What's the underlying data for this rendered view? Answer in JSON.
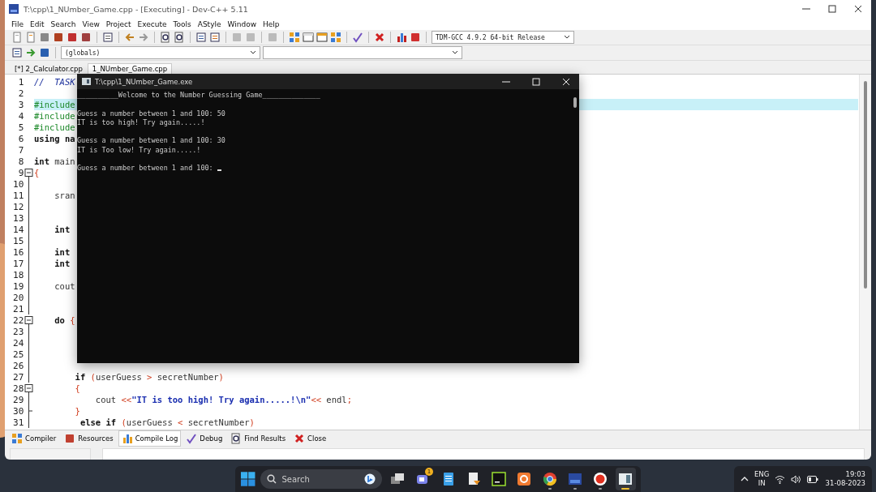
{
  "ide_window": {
    "title": "T:\\cpp\\1_NUmber_Game.cpp - [Executing] - Dev-C++ 5.11"
  },
  "menu": [
    "File",
    "Edit",
    "Search",
    "View",
    "Project",
    "Execute",
    "Tools",
    "AStyle",
    "Window",
    "Help"
  ],
  "compiler_select": {
    "value": "TDM-GCC 4.9.2 64-bit Release"
  },
  "scope_select": {
    "value": "(globals)"
  },
  "file_tabs": [
    {
      "label": "[*] 2_Calculator.cpp",
      "selected": false
    },
    {
      "label": "1_NUmber_Game.cpp",
      "selected": true
    }
  ],
  "code_lines": [
    {
      "number": "1",
      "kind": "plain",
      "highlighted": false,
      "segments": [
        {
          "text": "//  TASK",
          "kind": "comment"
        }
      ]
    },
    {
      "number": "2",
      "kind": "plain",
      "highlighted": false
    },
    {
      "number": "3",
      "kind": "plain",
      "highlighted": true,
      "segments": [
        {
          "text": "#include",
          "kind": "preproc"
        }
      ]
    },
    {
      "number": "4",
      "kind": "plain",
      "highlighted": false,
      "segments": [
        {
          "text": "#include",
          "kind": "preproc"
        }
      ]
    },
    {
      "number": "5",
      "kind": "plain",
      "highlighted": false,
      "segments": [
        {
          "text": "#include",
          "kind": "preproc"
        }
      ]
    },
    {
      "number": "6",
      "kind": "plain",
      "highlighted": false,
      "segments": [
        {
          "text": "using",
          "kind": "keyword"
        },
        {
          "text": " na",
          "kind": "keyword"
        }
      ]
    },
    {
      "number": "7",
      "kind": "plain",
      "highlighted": false
    },
    {
      "number": "8",
      "kind": "plain",
      "highlighted": false,
      "segments": [
        {
          "text": "int",
          "kind": "keyword"
        },
        {
          "text": " main",
          "kind": "plain"
        }
      ]
    },
    {
      "number": "9",
      "kind": "fold-start",
      "highlighted": false,
      "segments": [
        {
          "text": "{",
          "kind": "symbol"
        }
      ]
    },
    {
      "number": "10",
      "kind": "fold-inside",
      "highlighted": false
    },
    {
      "number": "11",
      "kind": "fold-inside",
      "highlighted": false,
      "segments": [
        {
          "text": "    sran",
          "kind": "plain"
        }
      ]
    },
    {
      "number": "12",
      "kind": "fold-inside",
      "highlighted": false
    },
    {
      "number": "13",
      "kind": "fold-inside",
      "highlighted": false
    },
    {
      "number": "14",
      "kind": "fold-inside",
      "highlighted": false,
      "segments": [
        {
          "text": "    int",
          "kind": "keyword"
        }
      ]
    },
    {
      "number": "15",
      "kind": "fold-inside",
      "highlighted": false
    },
    {
      "number": "16",
      "kind": "fold-inside",
      "highlighted": false,
      "segments": [
        {
          "text": "    int",
          "kind": "keyword"
        }
      ]
    },
    {
      "number": "17",
      "kind": "fold-inside",
      "highlighted": false,
      "segments": [
        {
          "text": "    int",
          "kind": "keyword"
        }
      ]
    },
    {
      "number": "18",
      "kind": "fold-inside",
      "highlighted": false
    },
    {
      "number": "19",
      "kind": "fold-inside",
      "highlighted": false,
      "segments": [
        {
          "text": "    cout",
          "kind": "plain"
        }
      ]
    },
    {
      "number": "20",
      "kind": "fold-inside",
      "highlighted": false
    },
    {
      "number": "21",
      "kind": "fold-inside",
      "highlighted": false
    },
    {
      "number": "22",
      "kind": "fold-start",
      "highlighted": false,
      "segments": [
        {
          "text": "    do",
          "kind": "keyword"
        },
        {
          "text": " {",
          "kind": "symbol"
        }
      ]
    },
    {
      "number": "23",
      "kind": "fold-inside",
      "highlighted": false
    },
    {
      "number": "24",
      "kind": "fold-inside",
      "highlighted": false
    },
    {
      "number": "25",
      "kind": "fold-inside",
      "highlighted": false
    },
    {
      "number": "26",
      "kind": "fold-inside",
      "highlighted": false
    },
    {
      "number": "27",
      "kind": "fold-inside",
      "highlighted": false,
      "segments": [
        {
          "text": "        if",
          "kind": "keyword"
        },
        {
          "text": " (",
          "kind": "symbol"
        },
        {
          "text": "userGuess ",
          "kind": "plain"
        },
        {
          "text": ">",
          "kind": "symbol"
        },
        {
          "text": " secretNumber",
          "kind": "plain"
        },
        {
          "text": ")",
          "kind": "symbol"
        }
      ]
    },
    {
      "number": "28",
      "kind": "fold-start",
      "highlighted": false,
      "segments": [
        {
          "text": "        {",
          "kind": "symbol"
        }
      ]
    },
    {
      "number": "29",
      "kind": "fold-inside",
      "highlighted": false,
      "segments": [
        {
          "text": "            cout ",
          "kind": "plain"
        },
        {
          "text": "<<",
          "kind": "symbol"
        },
        {
          "text": "\"IT is too high! Try again.....!\\n\"",
          "kind": "string"
        },
        {
          "text": "<<",
          "kind": "symbol"
        },
        {
          "text": " endl",
          "kind": "plain"
        },
        {
          "text": ";",
          "kind": "symbol"
        }
      ]
    },
    {
      "number": "30",
      "kind": "fold-end",
      "highlighted": false,
      "segments": [
        {
          "text": "        }",
          "kind": "symbol"
        }
      ]
    },
    {
      "number": "31",
      "kind": "fold-inside",
      "highlighted": false,
      "segments": [
        {
          "text": "         else if",
          "kind": "keyword"
        },
        {
          "text": " (",
          "kind": "symbol"
        },
        {
          "text": "userGuess ",
          "kind": "plain"
        },
        {
          "text": "<",
          "kind": "symbol"
        },
        {
          "text": " secretNumber",
          "kind": "plain"
        },
        {
          "text": ")",
          "kind": "symbol"
        }
      ]
    }
  ],
  "bottom_tabs": [
    {
      "label": "Compiler",
      "selected": false
    },
    {
      "label": "Resources",
      "selected": false
    },
    {
      "label": "Compile Log",
      "selected": true
    },
    {
      "label": "Debug",
      "selected": false
    },
    {
      "label": "Find Results",
      "selected": false
    },
    {
      "label": "Close",
      "selected": false
    }
  ],
  "console_window": {
    "title": "T:\\cpp\\1_NUmber_Game.exe",
    "blocks": [
      [
        "__________Welcome to the Number Guessing Game______________"
      ],
      [
        "Guess a number between 1 and 100: 50",
        "IT is too high! Try again.....!"
      ],
      [
        "Guess a number between 1 and 100: 30",
        "IT is Too low! Try again.....!"
      ],
      [
        "Guess a number between 1 and 100: "
      ]
    ]
  },
  "taskbar": {
    "search": {
      "placeholder": "Search"
    },
    "chat_badge": "1",
    "apps": [
      {
        "running": false,
        "selected": false
      },
      {
        "running": false,
        "selected": false
      },
      {
        "running": false,
        "selected": false
      },
      {
        "running": false,
        "selected": false
      },
      {
        "running": true,
        "selected": false
      },
      {
        "running": true,
        "selected": false
      },
      {
        "running": true,
        "selected": false
      },
      {
        "running": true,
        "selected": true
      }
    ],
    "language": [
      "ENG",
      "IN"
    ],
    "time": "19:03",
    "date": "31-08-2023"
  }
}
